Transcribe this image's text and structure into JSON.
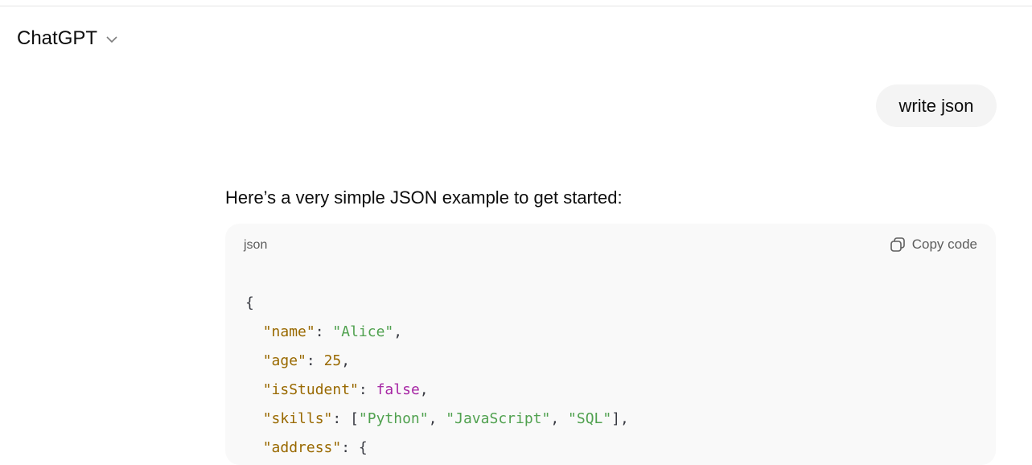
{
  "header": {
    "title": "ChatGPT",
    "dropdown_icon": "chevron-down-icon"
  },
  "user_message": "write json",
  "assistant": {
    "intro": "Here’s a very simple JSON example to get started:",
    "code_block": {
      "language": "json",
      "copy_label": "Copy code",
      "copy_icon": "copy-icon",
      "lines": [
        [
          {
            "t": "p",
            "v": "{"
          }
        ],
        [
          {
            "t": "p",
            "v": "  "
          },
          {
            "t": "k",
            "v": "\"name\""
          },
          {
            "t": "p",
            "v": ": "
          },
          {
            "t": "s",
            "v": "\"Alice\""
          },
          {
            "t": "p",
            "v": ","
          }
        ],
        [
          {
            "t": "p",
            "v": "  "
          },
          {
            "t": "k",
            "v": "\"age\""
          },
          {
            "t": "p",
            "v": ": "
          },
          {
            "t": "n",
            "v": "25"
          },
          {
            "t": "p",
            "v": ","
          }
        ],
        [
          {
            "t": "p",
            "v": "  "
          },
          {
            "t": "k",
            "v": "\"isStudent\""
          },
          {
            "t": "p",
            "v": ": "
          },
          {
            "t": "b",
            "v": "false"
          },
          {
            "t": "p",
            "v": ","
          }
        ],
        [
          {
            "t": "p",
            "v": "  "
          },
          {
            "t": "k",
            "v": "\"skills\""
          },
          {
            "t": "p",
            "v": ": ["
          },
          {
            "t": "s",
            "v": "\"Python\""
          },
          {
            "t": "p",
            "v": ", "
          },
          {
            "t": "s",
            "v": "\"JavaScript\""
          },
          {
            "t": "p",
            "v": ", "
          },
          {
            "t": "s",
            "v": "\"SQL\""
          },
          {
            "t": "p",
            "v": "],"
          }
        ],
        [
          {
            "t": "p",
            "v": "  "
          },
          {
            "t": "k",
            "v": "\"address\""
          },
          {
            "t": "p",
            "v": ": {"
          }
        ]
      ],
      "colors": {
        "key": "#996900",
        "string": "#50a14f",
        "boolean": "#a626a4",
        "number": "#996900"
      }
    }
  }
}
